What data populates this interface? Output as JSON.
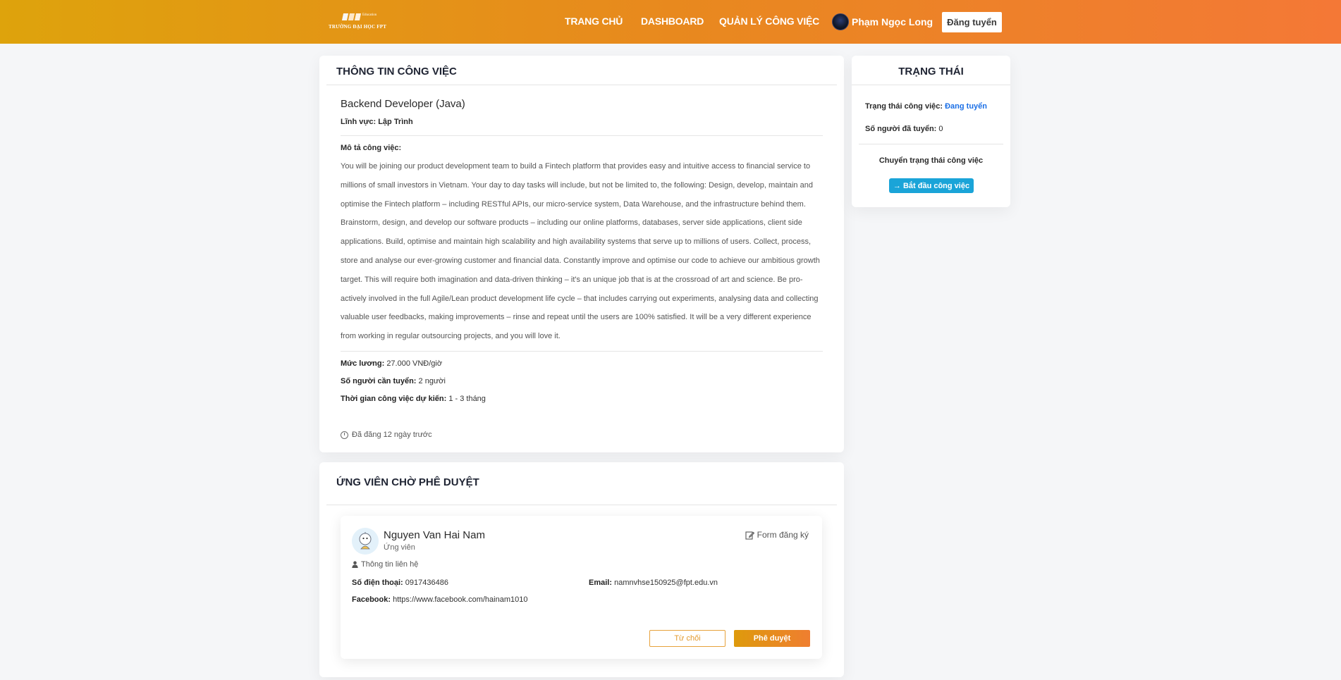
{
  "header": {
    "logo_small": "Education",
    "logo_text": "TRƯỜNG ĐẠI HỌC FPT",
    "nav": [
      "TRANG CHỦ",
      "DASHBOARD",
      "QUẢN LÝ CÔNG VIỆC"
    ],
    "user_name": "Phạm Ngọc Long",
    "post_button": "Đăng tuyển"
  },
  "job": {
    "section_title": "THÔNG TIN CÔNG VIỆC",
    "title": "Backend Developer (Java)",
    "field_label": "Lĩnh vực:",
    "field_value": "Lập Trình",
    "description_label": "Mô tả công việc:",
    "description": "You will be joining our product development team to build a Fintech platform that provides easy and intuitive access to financial service to millions of small investors in Vietnam. Your day to day tasks will include, but not be limited to, the following: Design, develop, maintain and optimise the Fintech platform – including RESTful APIs, our micro-service system, Data Warehouse, and the infrastructure behind them. Brainstorm, design, and develop our software products – including our online platforms, databases, server side applications, client side applications. Build, optimise and maintain high scalability and high availability systems that serve up to millions of users. Collect, process, store and analyse our ever-growing customer and financial data. Constantly improve and optimise our code to achieve our ambitious growth target. This will require both imagination and data-driven thinking – it's an unique job that is at the crossroad of art and science. Be pro-actively involved in the full Agile/Lean product development life cycle – that includes carrying out experiments, analysing data and collecting valuable user feedbacks, making improvements – rinse and repeat until the users are 100% satisfied. It will be a very different experience from working in regular outsourcing projects, and you will love it.",
    "salary_label": "Mức lương:",
    "salary_value": "27.000 VNĐ/giờ",
    "needed_label": "Số người cần tuyển:",
    "needed_value": "2 người",
    "duration_label": "Thời gian công việc dự kiến:",
    "duration_value": "1 - 3 tháng",
    "posted": "Đã đăng 12 ngày trước"
  },
  "status": {
    "section_title": "TRẠNG THÁI",
    "job_status_label": "Trạng thái công việc:",
    "job_status_value": "Đang tuyển",
    "hired_label": "Số người đã tuyển:",
    "hired_value": "0",
    "switch_label": "Chuyển trạng thái công việc",
    "start_button": "→ Bắt đầu công việc"
  },
  "candidates": {
    "section_title": "ỨNG VIÊN CHỜ PHÊ DUYỆT",
    "items": [
      {
        "name": "Nguyen Van Hai Nam",
        "role": "Ứng viên",
        "form_link": "Form đăng ký",
        "contact_heading": "Thông tin liên hệ",
        "phone_label": "Số điện thoại:",
        "phone": "0917436486",
        "email_label": "Email:",
        "email": "namnvhse150925@fpt.edu.vn",
        "facebook_label": "Facebook:",
        "facebook": "https://www.facebook.com/hainam1010",
        "reject_button": "Từ chối",
        "approve_button": "Phê duyệt"
      }
    ]
  },
  "colors": {
    "header_gradient_start": "#dea30c",
    "header_gradient_end": "#f47836",
    "status_link": "#1b6fe6",
    "start_button": "#1aa4d8"
  }
}
